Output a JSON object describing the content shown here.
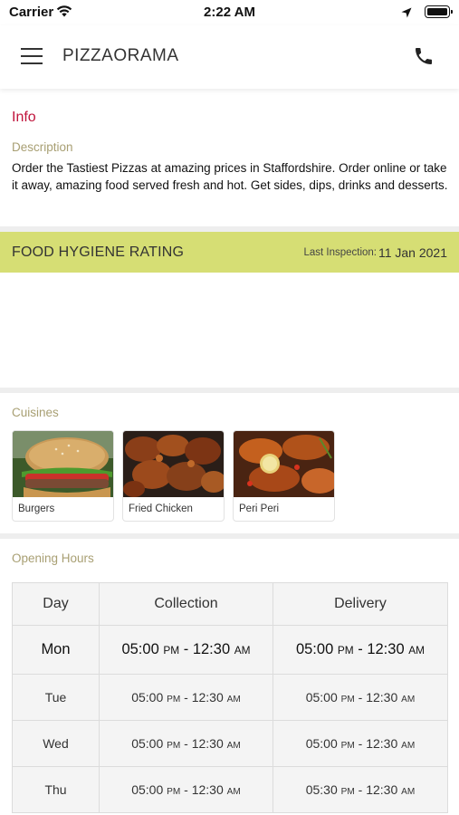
{
  "status_bar": {
    "carrier": "Carrier",
    "time": "2:22 AM"
  },
  "nav": {
    "title": "PIZZAORAMA",
    "menu_icon": "hamburger-menu-icon",
    "phone_icon": "phone-icon"
  },
  "info": {
    "title": "Info",
    "description_label": "Description",
    "description": "Order the Tastiest Pizzas at amazing prices in Staffordshire. Order online or take it away, amazing food served fresh and hot. Get sides, dips, drinks and desserts."
  },
  "hygiene": {
    "title": "FOOD HYGIENE RATING",
    "last_inspection_label": "Last Inspection:",
    "last_inspection_date": "11 Jan 2021"
  },
  "cuisines": {
    "label": "Cuisines",
    "items": [
      {
        "name": "Burgers"
      },
      {
        "name": "Fried Chicken"
      },
      {
        "name": "Peri Peri"
      }
    ]
  },
  "opening_hours": {
    "label": "Opening Hours",
    "columns": [
      "Day",
      "Collection",
      "Delivery"
    ],
    "rows": [
      {
        "day": "Mon",
        "collection": {
          "open": "05:00",
          "open_suffix": "PM",
          "close": "12:30",
          "close_suffix": "AM"
        },
        "delivery": {
          "open": "05:00",
          "open_suffix": "PM",
          "close": "12:30",
          "close_suffix": "AM"
        }
      },
      {
        "day": "Tue",
        "collection": {
          "open": "05:00",
          "open_suffix": "PM",
          "close": "12:30",
          "close_suffix": "AM"
        },
        "delivery": {
          "open": "05:00",
          "open_suffix": "PM",
          "close": "12:30",
          "close_suffix": "AM"
        }
      },
      {
        "day": "Wed",
        "collection": {
          "open": "05:00",
          "open_suffix": "PM",
          "close": "12:30",
          "close_suffix": "AM"
        },
        "delivery": {
          "open": "05:00",
          "open_suffix": "PM",
          "close": "12:30",
          "close_suffix": "AM"
        }
      },
      {
        "day": "Thu",
        "collection": {
          "open": "05:00",
          "open_suffix": "PM",
          "close": "12:30",
          "close_suffix": "AM"
        },
        "delivery": {
          "open": "05:30",
          "open_suffix": "PM",
          "close": "12:30",
          "close_suffix": "AM"
        }
      }
    ]
  },
  "colors": {
    "accent_red": "#c0143c",
    "label_olive": "#a89f73",
    "hygiene_band": "#d6de74"
  }
}
